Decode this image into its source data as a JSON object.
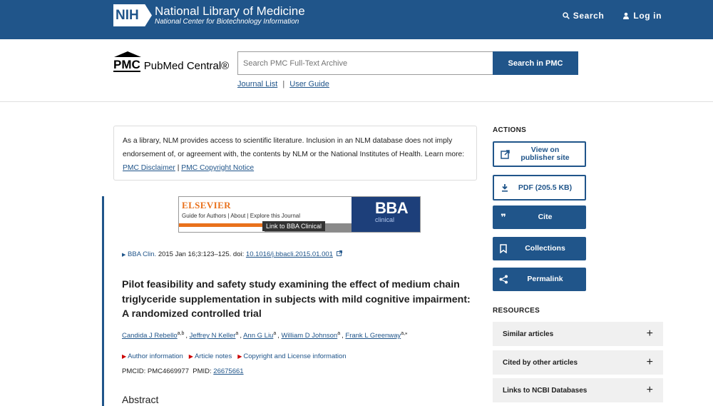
{
  "header": {
    "nih_badge": "NIH",
    "title": "National Library of Medicine",
    "subtitle": "National Center for Biotechnology Information",
    "search_label": "Search",
    "login_label": "Log in"
  },
  "pmc": {
    "mark": "PMC",
    "name": "PubMed Central®",
    "search_placeholder": "Search PMC Full-Text Archive",
    "search_button": "Search in PMC",
    "journal_list": "Journal List",
    "separator": "|",
    "user_guide": "User Guide"
  },
  "disclaimer": {
    "text": "As a library, NLM provides access to scientific literature. Inclusion in an NLM database does not imply endorsement of, or agreement with, the contents by NLM or the National Institutes of Health.",
    "learn_more": "Learn more:",
    "link1": "PMC Disclaimer",
    "sep": "|",
    "link2": "PMC Copyright Notice"
  },
  "banner": {
    "publisher": "ELSEVIER",
    "links": "Guide for Authors | About | Explore this Journal",
    "journal_title": "BBA",
    "journal_sub": "clinical",
    "tooltip": "Link to BBA Clinical"
  },
  "citation": {
    "journal": "BBA Clin.",
    "details": "2015 Jan 16;3:123–125. doi:",
    "doi": "10.1016/j.bbacli.2015.01.001"
  },
  "article": {
    "title": "Pilot feasibility and safety study examining the effect of medium chain triglyceride supplementation in subjects with mild cognitive impairment: A randomized controlled trial",
    "authors": [
      {
        "name": "Candida J Rebello",
        "sup": "a,b"
      },
      {
        "name": "Jeffrey N Keller",
        "sup": "a"
      },
      {
        "name": "Ann G Liu",
        "sup": "a"
      },
      {
        "name": "William D Johnson",
        "sup": "a"
      },
      {
        "name": "Frank L Greenway",
        "sup": "a,⁎"
      }
    ],
    "info_links": [
      "Author information",
      "Article notes",
      "Copyright and License information"
    ],
    "pmcid_label": "PMCID: PMC4669977",
    "pmid_label": "PMID:",
    "pmid": "26675661",
    "abstract_heading": "Abstract"
  },
  "sidebar": {
    "actions_heading": "ACTIONS",
    "actions": [
      "View on publisher site",
      "PDF (205.5 KB)",
      "Cite",
      "Collections",
      "Permalink"
    ],
    "resources_heading": "RESOURCES",
    "resources": [
      "Similar articles",
      "Cited by other articles",
      "Links to NCBI Databases"
    ],
    "plus": "+"
  },
  "colors": {
    "brand_blue": "#20558a",
    "elsevier_orange": "#e9711c",
    "resource_bg": "#f0f0f0"
  }
}
